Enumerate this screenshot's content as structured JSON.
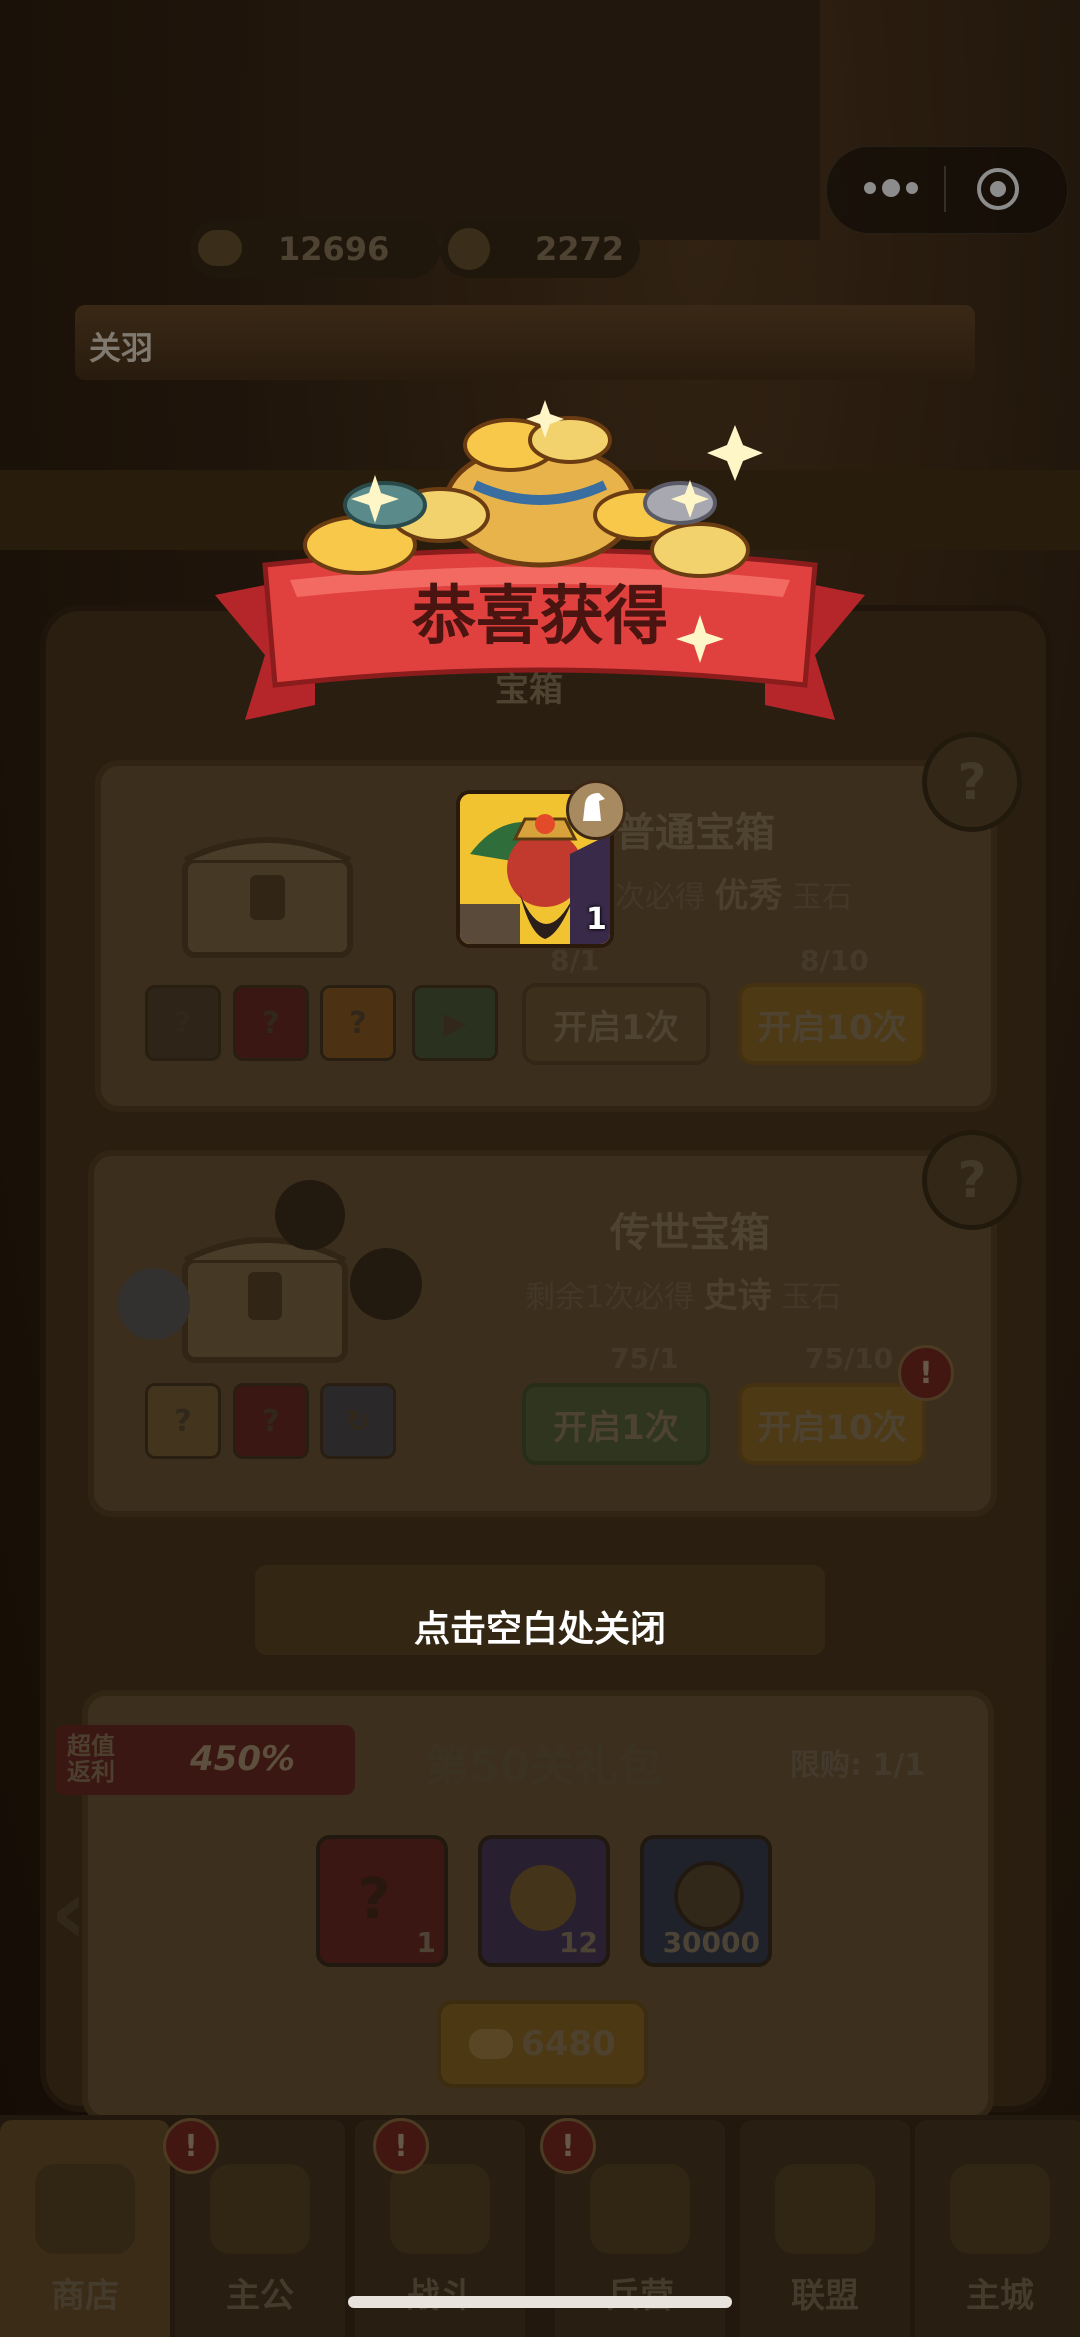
{
  "resources": {
    "gold": "12696",
    "coins": "2272"
  },
  "hero_strip_name": "关羽",
  "reward": {
    "title": "恭喜获得",
    "item_count": "1",
    "close_hint": "点击空白处关闭",
    "icons": [
      "gold-ingot-pile-icon",
      "sparkle-icon",
      "horse-badge-icon"
    ]
  },
  "shop": {
    "section_header": "宝箱",
    "normal_chest": {
      "title": "普通宝箱",
      "subtitle_prefix": "次必得",
      "subtitle_quality": "优秀",
      "subtitle_suffix": "玉石",
      "key_count_1": "8/1",
      "key_count_10": "8/10",
      "btn_open_1": "开启1次",
      "btn_open_10": "开启10次"
    },
    "legend_chest": {
      "title": "传世宝箱",
      "subtitle_prefix": "剩余1次必得",
      "subtitle_quality": "史诗",
      "subtitle_suffix": "玉石",
      "key_count_1": "75/1",
      "key_count_10": "75/10",
      "btn_open_1": "开启1次",
      "btn_open_10": "开启10次"
    },
    "bundle": {
      "promo_label_line1": "超值",
      "promo_label_line2": "返利",
      "promo_pct": "450%",
      "title": "第50关礼包",
      "limit": "限购: 1/1",
      "items": [
        {
          "icon": "mystery-box-icon",
          "count": "1",
          "color": "#6a2a22"
        },
        {
          "icon": "dragon-orb-icon",
          "count": "12",
          "color": "#4a3a5a"
        },
        {
          "icon": "copper-coin-icon",
          "count": "30000",
          "color": "#3a3f4e"
        }
      ],
      "price": "6480"
    }
  },
  "nav": {
    "tabs": [
      {
        "label": "商店",
        "active": true,
        "badge": "!"
      },
      {
        "label": "主公",
        "active": false,
        "badge": "!"
      },
      {
        "label": "战斗",
        "active": false,
        "badge": "!"
      },
      {
        "label": "兵营",
        "active": false,
        "badge": ""
      },
      {
        "label": "联盟",
        "active": false,
        "badge": ""
      },
      {
        "label": "主城",
        "active": false,
        "badge": ""
      }
    ]
  },
  "colors": {
    "banner_red": "#d8383a",
    "gold": "#f2c331",
    "overlay": "rgba(0,0,0,0.55)"
  }
}
